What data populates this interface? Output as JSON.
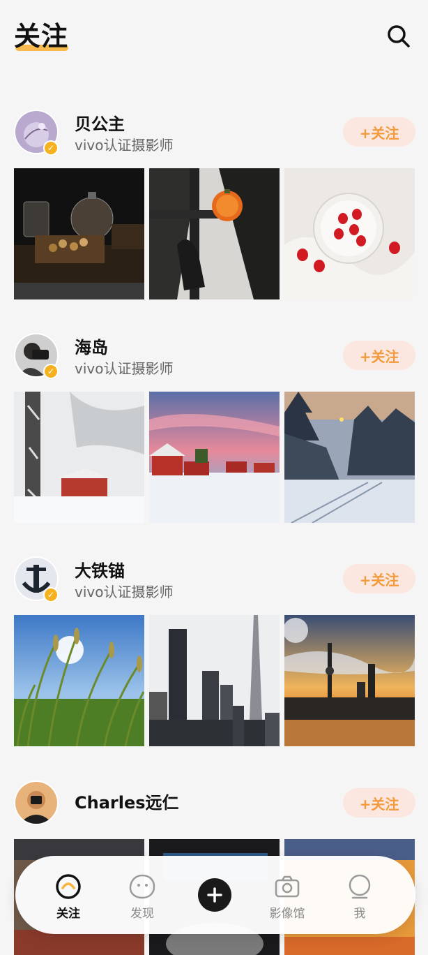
{
  "header": {
    "title": "关注",
    "search_icon": "search-icon"
  },
  "posts": [
    {
      "name": "贝公主",
      "subtitle": "vivo认证摄影师",
      "verified": true,
      "follow_label": "+关注",
      "photos": [
        "still-life-jars",
        "window-shadow-persimmon",
        "strawberries-plate"
      ]
    },
    {
      "name": "海岛",
      "subtitle": "vivo认证摄影师",
      "verified": true,
      "follow_label": "+关注",
      "photos": [
        "snow-red-cabin",
        "pink-sky-red-houses",
        "snowy-forest-road"
      ]
    },
    {
      "name": "大铁锚",
      "subtitle": "vivo认证摄影师",
      "verified": true,
      "follow_label": "+关注",
      "photos": [
        "rice-field-sun",
        "city-towers",
        "skyline-sunset"
      ]
    },
    {
      "name": "Charles远仁",
      "subtitle": "",
      "verified": false,
      "follow_label": "+关注",
      "photos": [
        "street-crowd",
        "dark-scene",
        "orange-sky"
      ]
    }
  ],
  "tabbar": {
    "tabs": [
      {
        "label": "关注",
        "icon": "follow-icon",
        "active": true
      },
      {
        "label": "发现",
        "icon": "discover-icon",
        "active": false
      },
      {
        "label": "影像馆",
        "icon": "camera-icon",
        "active": false
      },
      {
        "label": "我",
        "icon": "profile-icon",
        "active": false
      }
    ],
    "add_icon": "plus-icon"
  },
  "colors": {
    "accent": "#f39a3c",
    "follow_bg": "#fbe7df",
    "badge": "#f5b11f",
    "underline": "#f7b43c"
  }
}
